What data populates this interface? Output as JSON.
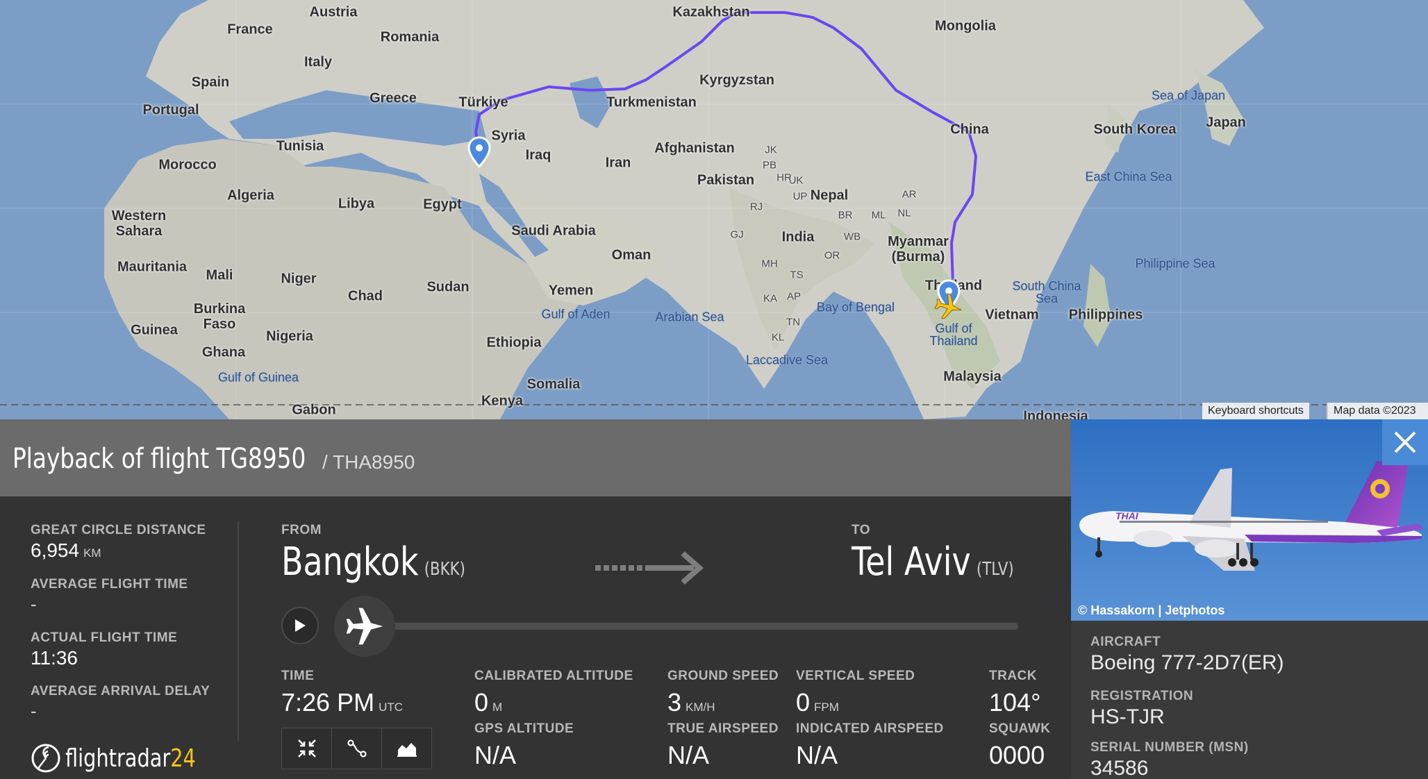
{
  "map": {
    "countries": [
      "France",
      "Austria",
      "Romania",
      "Italy",
      "Spain",
      "Portugal",
      "Greece",
      "Türkiye",
      "Syria",
      "Iraq",
      "Iran",
      "Tunisia",
      "Morocco",
      "Algeria",
      "Libya",
      "Egypt",
      "Western Sahara",
      "Mauritania",
      "Mali",
      "Niger",
      "Chad",
      "Sudan",
      "Burkina Faso",
      "Guinea",
      "Ghana",
      "Nigeria",
      "Ethiopia",
      "Somalia",
      "Kenya",
      "Gabon",
      "Saudi Arabia",
      "Oman",
      "Yemen",
      "Turkmenistan",
      "Afghanistan",
      "Pakistan",
      "India",
      "Nepal",
      "Kazakhstan",
      "Kyrgyzstan",
      "Mongolia",
      "China",
      "South Korea",
      "Japan",
      "Myanmar (Burma)",
      "Thailand",
      "Vietnam",
      "Philippines",
      "Malaysia",
      "Indonesia"
    ],
    "seas": [
      "Sea of Japan",
      "East China Sea",
      "Philippine Sea",
      "South China Sea",
      "Gulf of Thailand",
      "Bay of Bengal",
      "Laccadive Sea",
      "Arabian Sea",
      "Gulf of Aden",
      "Gulf of Guinea"
    ],
    "regions": [
      "JK",
      "PB",
      "UK",
      "HR",
      "UP",
      "RJ",
      "GJ",
      "BR",
      "WB",
      "AR",
      "ML",
      "NL",
      "MH",
      "OR",
      "TS",
      "KA",
      "AP",
      "TN",
      "KL"
    ],
    "route_color": "#6b47f0",
    "attribution": [
      "Keyboard shortcuts",
      "Map data ©2023"
    ]
  },
  "flight": {
    "title": "Playback of flight TG8950",
    "callsign": "/ THA8950"
  },
  "stats": {
    "great_circle_label": "GREAT CIRCLE DISTANCE",
    "great_circle_value": "6,954",
    "great_circle_unit": "KM",
    "avg_flight_time_label": "AVERAGE FLIGHT TIME",
    "avg_flight_time_value": "-",
    "actual_flight_time_label": "ACTUAL FLIGHT TIME",
    "actual_flight_time_value": "11:36",
    "avg_arrival_delay_label": "AVERAGE ARRIVAL DELAY",
    "avg_arrival_delay_value": "-"
  },
  "route": {
    "from_label": "FROM",
    "from_city": "Bangkok",
    "from_code": "(BKK)",
    "to_label": "TO",
    "to_city": "Tel Aviv",
    "to_code": "(TLV)"
  },
  "playback": {
    "progress": 0.0
  },
  "telemetry": {
    "time_label": "TIME",
    "time_value": "7:26 PM",
    "time_unit": "UTC",
    "cal_alt_label": "CALIBRATED ALTITUDE",
    "cal_alt_value": "0",
    "cal_alt_unit": "M",
    "ground_speed_label": "GROUND SPEED",
    "ground_speed_value": "3",
    "ground_speed_unit": "KM/H",
    "vertical_speed_label": "VERTICAL SPEED",
    "vertical_speed_value": "0",
    "vertical_speed_unit": "FPM",
    "track_label": "TRACK",
    "track_value": "104°",
    "gps_alt_label": "GPS ALTITUDE",
    "gps_alt_value": "N/A",
    "true_airspeed_label": "TRUE AIRSPEED",
    "true_airspeed_value": "N/A",
    "indicated_airspeed_label": "INDICATED AIRSPEED",
    "indicated_airspeed_value": "N/A",
    "squawk_label": "SQUAWK",
    "squawk_value": "0000"
  },
  "logo": {
    "text_main": "flightradar",
    "text_accent": "24"
  },
  "aircraft": {
    "photo_credit": "© Hassakorn | Jetphotos",
    "aircraft_label": "AIRCRAFT",
    "aircraft_value": "Boeing 777-2D7(ER)",
    "registration_label": "REGISTRATION",
    "registration_value": "HS-TJR",
    "serial_label": "SERIAL NUMBER (MSN)",
    "serial_value": "34586",
    "livery_text": "THAI"
  }
}
